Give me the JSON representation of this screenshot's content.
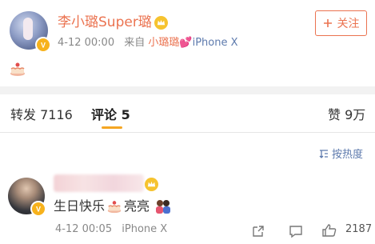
{
  "post": {
    "username": "李小璐Super璐",
    "timestamp": "4-12 00:00",
    "source_prefix": "来自",
    "source_name": "小璐璐",
    "device": "iPhone X",
    "follow_label": "关注",
    "accent_color": "#eb7350",
    "link_color": "#5d7aad"
  },
  "tabs": [
    {
      "label": "转发",
      "count": "7116"
    },
    {
      "label": "评论",
      "count": "5"
    },
    {
      "label": "赞",
      "count": "9万"
    }
  ],
  "sort_label": "按热度",
  "comment": {
    "text": "生日快乐",
    "text_after": "亮亮",
    "timestamp": "4-12 00:05",
    "device": "iPhone X",
    "like_count": "2187"
  },
  "icons": [
    "verified-badge-icon",
    "crown-icon",
    "cake-icon",
    "plus-icon",
    "sort-icon",
    "share-icon",
    "comment-icon",
    "like-icon",
    "couple-emoji-icon",
    "heart-icon"
  ]
}
